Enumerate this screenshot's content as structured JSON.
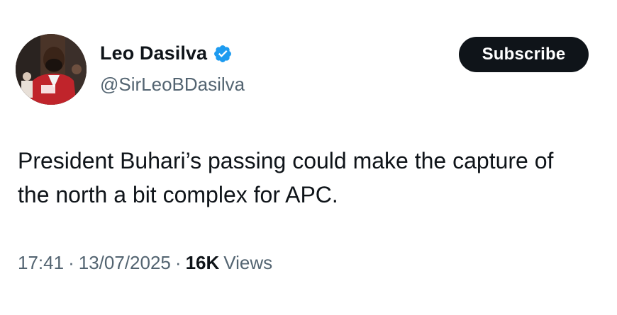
{
  "author": {
    "display_name": "Leo Dasilva",
    "handle": "@SirLeoBDasilva",
    "verified_icon": "verified-badge-icon",
    "verified_color": "#1d9bf0"
  },
  "subscribe": {
    "label": "Subscribe"
  },
  "tweet": {
    "text": "President Buhari’s passing could make the capture of the north a bit complex for APC."
  },
  "meta": {
    "time": "17:41",
    "separator": "·",
    "date": "13/07/2025",
    "views_count": "16K",
    "views_label": "Views"
  },
  "colors": {
    "text_primary": "#0f1419",
    "text_secondary": "#536471",
    "button_bg": "#0f1419",
    "button_text": "#ffffff"
  }
}
